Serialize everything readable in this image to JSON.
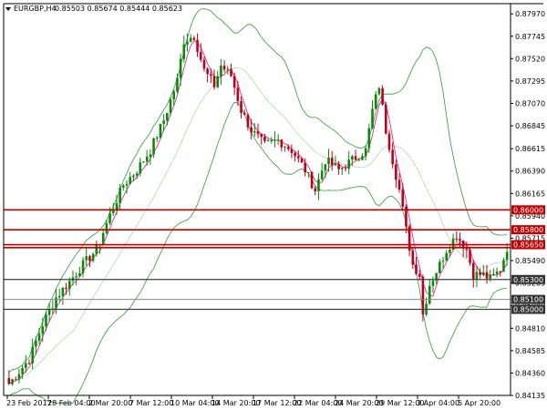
{
  "header": {
    "symbol": "EURGBP,H4",
    "ohlc": "0.85503 0.85674 0.85444 0.85623"
  },
  "colors": {
    "bull": "#0a8a0a",
    "bear": "#c0001a",
    "bollinger": "#2e9a3a",
    "ma": "#e0308a",
    "level_red": "#c00000",
    "level_dark": "#404040",
    "level_light": "#8a8a8a",
    "label_red_bg": "#c00000",
    "label_dark_bg": "#333333",
    "label_text": "#ffffff"
  },
  "chart_data": {
    "type": "candlestick",
    "y_range": [
      0.84135,
      0.8799
    ],
    "y_ticks": [
      "0.87970",
      "0.87745",
      "0.87520",
      "0.87295",
      "0.87070",
      "0.86845",
      "0.86615",
      "0.86390",
      "0.86165",
      "0.85940",
      "0.85715",
      "0.85490",
      "0.85265",
      "0.85040",
      "0.84810",
      "0.84585",
      "0.84360",
      "0.84135"
    ],
    "x_labels": [
      "23 Feb 2017",
      "28 Feb 04:00",
      "2 Mar 20:00",
      "7 Mar 12:00",
      "10 Mar 04:00",
      "14 Mar 20:00",
      "17 Mar 12:00",
      "22 Mar 04:00",
      "24 Mar 20:00",
      "29 Mar 12:00",
      "3 Apr 04:00",
      "5 Apr 20:00"
    ],
    "levels": [
      {
        "price": 0.86,
        "label": "0.86000",
        "style": "red"
      },
      {
        "price": 0.858,
        "label": "0.85800",
        "style": "red"
      },
      {
        "price": 0.8565,
        "label": "0.85650",
        "style": "red"
      },
      {
        "price": 0.8562,
        "label": "",
        "style": "red"
      },
      {
        "price": 0.853,
        "label": "0.85300",
        "style": "dark"
      },
      {
        "price": 0.851,
        "label": "0.85100",
        "style": "light"
      },
      {
        "price": 0.85,
        "label": "0.85000",
        "style": "dark"
      }
    ],
    "close_anchors": [
      [
        0,
        0.8425
      ],
      [
        6,
        0.845
      ],
      [
        10,
        0.8485
      ],
      [
        14,
        0.8512
      ],
      [
        18,
        0.8528
      ],
      [
        22,
        0.8545
      ],
      [
        26,
        0.856
      ],
      [
        30,
        0.8595
      ],
      [
        34,
        0.8625
      ],
      [
        38,
        0.864
      ],
      [
        42,
        0.866
      ],
      [
        46,
        0.869
      ],
      [
        50,
        0.873
      ],
      [
        52,
        0.877
      ],
      [
        55,
        0.8775
      ],
      [
        58,
        0.874
      ],
      [
        61,
        0.8725
      ],
      [
        63,
        0.8745
      ],
      [
        66,
        0.8735
      ],
      [
        69,
        0.87
      ],
      [
        72,
        0.868
      ],
      [
        76,
        0.8665
      ],
      [
        80,
        0.867
      ],
      [
        84,
        0.866
      ],
      [
        88,
        0.864
      ],
      [
        91,
        0.862
      ],
      [
        94,
        0.865
      ],
      [
        98,
        0.864
      ],
      [
        102,
        0.865
      ],
      [
        106,
        0.866
      ],
      [
        108,
        0.87
      ],
      [
        110,
        0.8725
      ],
      [
        112,
        0.868
      ],
      [
        114,
        0.865
      ],
      [
        116,
        0.862
      ],
      [
        118,
        0.858
      ],
      [
        120,
        0.8545
      ],
      [
        122,
        0.8535
      ],
      [
        123,
        0.8495
      ],
      [
        125,
        0.8525
      ],
      [
        128,
        0.8545
      ],
      [
        130,
        0.856
      ],
      [
        133,
        0.8575
      ],
      [
        136,
        0.856
      ],
      [
        138,
        0.8535
      ],
      [
        141,
        0.8535
      ],
      [
        143,
        0.853
      ],
      [
        146,
        0.854
      ],
      [
        148,
        0.8562
      ]
    ]
  }
}
